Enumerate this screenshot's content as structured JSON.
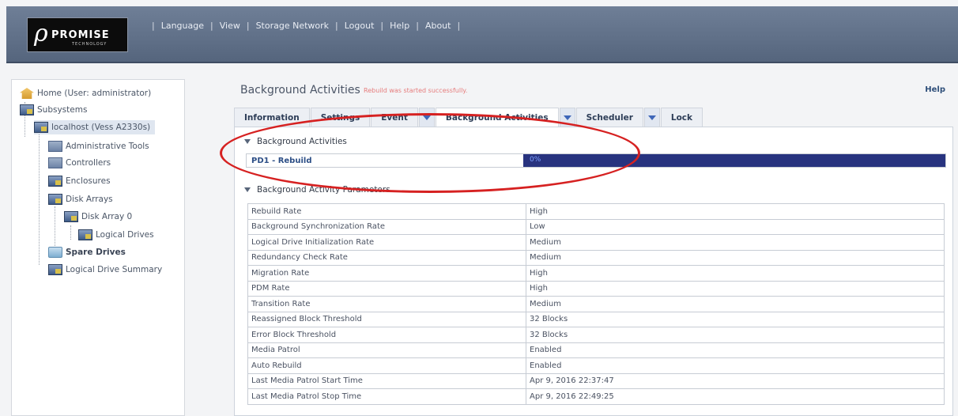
{
  "header": {
    "logo": {
      "brand": "PROMISE",
      "sub": "TECHNOLOGY"
    },
    "menu": [
      "Language",
      "View",
      "Storage Network",
      "Logout",
      "Help",
      "About"
    ]
  },
  "sidebar": {
    "items": [
      {
        "label": "Home (User: administrator)",
        "icon": "home-icon"
      },
      {
        "label": "Subsystems",
        "icon": "subsystem-icon"
      },
      {
        "label": "localhost (Vess A2330s)",
        "icon": "host-icon"
      },
      {
        "label": "Administrative Tools",
        "icon": "tools-icon"
      },
      {
        "label": "Controllers",
        "icon": "controller-icon"
      },
      {
        "label": "Enclosures",
        "icon": "enclosure-icon"
      },
      {
        "label": "Disk Arrays",
        "icon": "disk-arrays-icon"
      },
      {
        "label": "Disk Array 0",
        "icon": "disk-array-icon"
      },
      {
        "label": "Logical Drives",
        "icon": "logical-drives-icon"
      },
      {
        "label": "Spare Drives",
        "icon": "spare-drives-icon"
      },
      {
        "label": "Logical Drive Summary",
        "icon": "summary-icon"
      }
    ]
  },
  "main": {
    "title": "Background Activities",
    "message": "Rebuild was started successfully.",
    "help": "Help",
    "tabs": [
      "Information",
      "Settings",
      "Event",
      "Background Activities",
      "Scheduler",
      "Lock"
    ],
    "activities_section": "Background Activities",
    "activity": {
      "label": "PD1 - Rebuild",
      "progress": 0,
      "progress_text": "0%"
    },
    "params_section": "Background Activity Parameters",
    "params": [
      [
        "Rebuild Rate",
        "High"
      ],
      [
        "Background Synchronization Rate",
        "Low"
      ],
      [
        "Logical Drive Initialization Rate",
        "Medium"
      ],
      [
        "Redundancy Check Rate",
        "Medium"
      ],
      [
        "Migration Rate",
        "High"
      ],
      [
        "PDM Rate",
        "High"
      ],
      [
        "Transition Rate",
        "Medium"
      ],
      [
        "Reassigned Block Threshold",
        "32 Blocks"
      ],
      [
        "Error Block Threshold",
        "32 Blocks"
      ],
      [
        "Media Patrol",
        "Enabled"
      ],
      [
        "Auto Rebuild",
        "Enabled"
      ],
      [
        "Last Media Patrol Start Time",
        "Apr 9, 2016 22:37:47"
      ],
      [
        "Last Media Patrol Stop Time",
        "Apr 9, 2016 22:49:25"
      ]
    ]
  },
  "colors": {
    "header": "#5f6f88",
    "progress_track": "#28337f",
    "annotation": "#d62121",
    "link": "#2c4e86"
  }
}
